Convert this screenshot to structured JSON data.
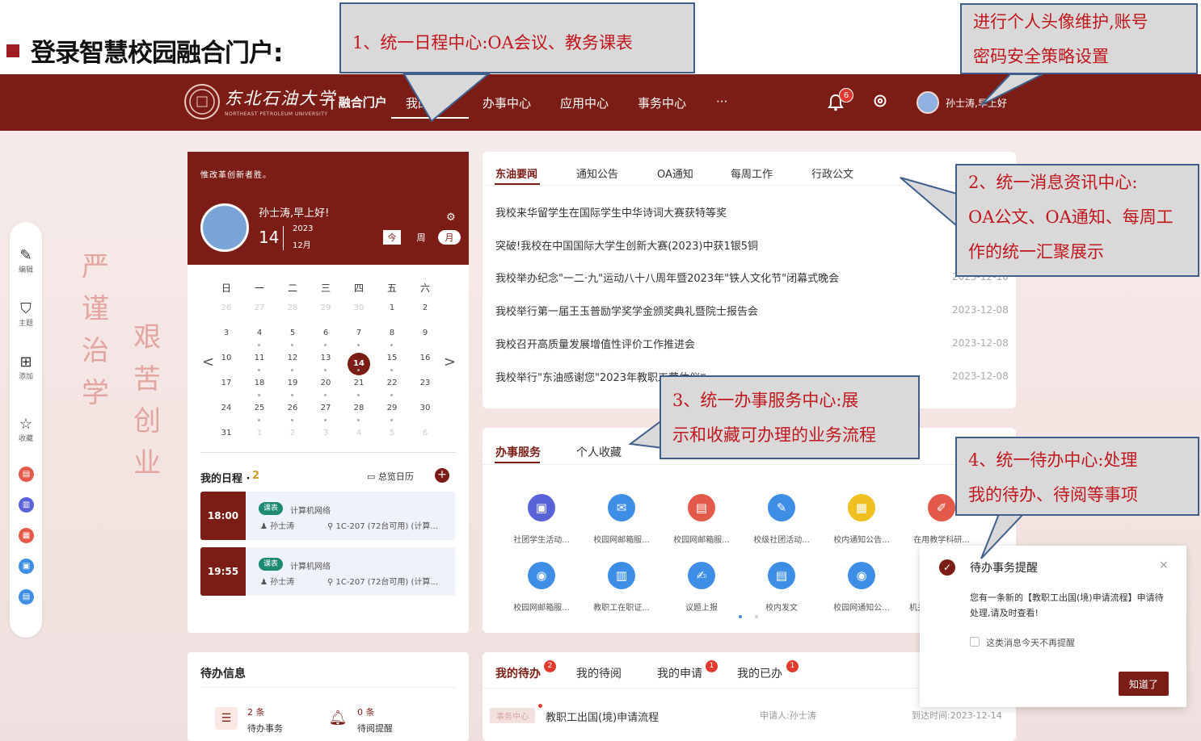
{
  "slide": {
    "title": "登录智慧校园融合门户:"
  },
  "callouts": {
    "c1": "1、统一日程中心:OA会议、教务课表",
    "c_top_right": [
      "进行个人头像维护,账号",
      "密码安全策略设置"
    ],
    "c2": [
      "2、统一消息资讯中心:",
      "OA公文、OA通知、每周工",
      "作的统一汇聚展示"
    ],
    "c3": [
      "3、统一办事服务中心:展",
      "示和收藏可办理的业务流程"
    ],
    "c4": [
      "4、统一待办中心:处理",
      "我的待办、待阅等事项"
    ]
  },
  "nav": {
    "university": "东北石油大学",
    "university_en": "NORTHEAST PETROLEUM UNIVERSITY",
    "portal": "| 融合门户",
    "items": [
      "我的门户",
      "办事中心",
      "应用中心",
      "事务中心",
      "···"
    ],
    "bell_badge": "6",
    "user": "孙士涛,早上好"
  },
  "deco": {
    "col1": [
      "严",
      "谨",
      "治",
      "学"
    ],
    "col2": [
      "艰",
      "苦",
      "创",
      "业"
    ]
  },
  "left_toolbar": [
    {
      "icon": "edit-icon",
      "label": "编辑"
    },
    {
      "icon": "theme-icon",
      "label": "主题"
    },
    {
      "icon": "add-icon",
      "label": "添加"
    },
    {
      "icon": "star-icon",
      "label": "收藏"
    }
  ],
  "calendar": {
    "motto": "惟改革创新者胜。",
    "greeting": "孙士涛,早上好!",
    "day": "14",
    "year": "2023",
    "month": "12月",
    "today_btn": "今",
    "week_btn": "周",
    "month_btn": "月",
    "weekdays": [
      "日",
      "一",
      "二",
      "三",
      "四",
      "五",
      "六"
    ],
    "prev": "<",
    "next": ">",
    "weeks": [
      [
        "26",
        "27",
        "28",
        "29",
        "30",
        "1",
        "2"
      ],
      [
        "3",
        "4",
        "5",
        "6",
        "7",
        "8",
        "9"
      ],
      [
        "10",
        "11",
        "12",
        "13",
        "14",
        "15",
        "16"
      ],
      [
        "17",
        "18",
        "19",
        "20",
        "21",
        "22",
        "23"
      ],
      [
        "24",
        "25",
        "26",
        "27",
        "28",
        "29",
        "30"
      ],
      [
        "31",
        "1",
        "2",
        "3",
        "4",
        "5",
        "6"
      ]
    ]
  },
  "schedule": {
    "title": "我的日程 ·",
    "count": "2",
    "all_label": "总览日历",
    "events": [
      {
        "time": "18:00",
        "tag": "课表",
        "name": "计算机网络",
        "person": "孙士涛",
        "place": "1C-207 (72台可用) (计算..."
      },
      {
        "time": "19:55",
        "tag": "课表",
        "name": "计算机网络",
        "person": "孙士涛",
        "place": "1C-207 (72台可用) (计算..."
      }
    ]
  },
  "news": {
    "tabs": [
      "东油要闻",
      "通知公告",
      "OA通知",
      "每周工作",
      "行政公文"
    ],
    "items": [
      {
        "title": "我校来华留学生在国际学生中华诗词大赛获特等奖",
        "date": ""
      },
      {
        "title": "突破!我校在中国国际大学生创新大赛(2023)中获1银5铜",
        "date": ""
      },
      {
        "title": "我校举办纪念\"一二·九\"运动八十八周年暨2023年\"铁人文化节\"闭幕式晚会",
        "date": "2023-12-10"
      },
      {
        "title": "我校举行第一届王玉普励学奖学金颁奖典礼暨院士报告会",
        "date": "2023-12-08"
      },
      {
        "title": "我校召开高质量发展增值性评价工作推进会",
        "date": "2023-12-08"
      },
      {
        "title": "我校举行\"东油感谢您\"2023年教职工荣休仪式",
        "date": "2023-12-08"
      }
    ]
  },
  "services": {
    "tabs": [
      "办事服务",
      "个人收藏"
    ],
    "items": [
      {
        "label": "社团学生活动...",
        "color": "#5a62d8",
        "icon": "basket-icon",
        "glyph": "▣"
      },
      {
        "label": "校园网邮箱服...",
        "color": "#3f8ee6",
        "icon": "mail-icon",
        "glyph": "✉"
      },
      {
        "label": "校园网邮箱服...",
        "color": "#e45a4a",
        "icon": "doc-lock-icon",
        "glyph": "▤"
      },
      {
        "label": "校级社团活动...",
        "color": "#3f8ee6",
        "icon": "form-icon",
        "glyph": "✎"
      },
      {
        "label": "校内通知公告...",
        "color": "#f0c020",
        "icon": "notice-icon",
        "glyph": "▦"
      },
      {
        "label": "在用教学科研...",
        "color": "#e45a4a",
        "icon": "tool-icon",
        "glyph": "✐"
      },
      {
        "label": "校园网邮箱服...",
        "color": "#3f8ee6",
        "icon": "user-icon",
        "glyph": "◉"
      },
      {
        "label": "教职工在职证...",
        "color": "#3f8ee6",
        "icon": "certificate-icon",
        "glyph": "▥"
      },
      {
        "label": "议题上报",
        "color": "#3f8ee6",
        "icon": "report-icon",
        "glyph": "✍"
      },
      {
        "label": "校内发文",
        "color": "#3f8ee6",
        "icon": "file-icon",
        "glyph": "▤"
      },
      {
        "label": "校园网通知公...",
        "color": "#3f8ee6",
        "icon": "user-icon",
        "glyph": "◉"
      },
      {
        "label": "机关",
        "color": "#3f8ee6",
        "icon": "building-icon",
        "glyph": "▦"
      }
    ]
  },
  "todo": {
    "title": "待办信息",
    "items": [
      {
        "count": "2 条",
        "label": "待办事务"
      },
      {
        "count": "0 条",
        "label": "待阅提醒"
      }
    ]
  },
  "mytodo": {
    "tabs": [
      {
        "label": "我的待办",
        "badge": "2"
      },
      {
        "label": "我的待阅",
        "badge": ""
      },
      {
        "label": "我的申请",
        "badge": "1"
      },
      {
        "label": "我的已办",
        "badge": "1"
      }
    ],
    "row": {
      "tag": "事务中心",
      "title": "教职工出国(境)申请流程",
      "applicant": "申请人:孙士涛",
      "arrive": "到达时间:2023-12-14"
    }
  },
  "popup": {
    "title": "待办事务提醒",
    "close": "×",
    "message": "您有一条新的【教职工出国(境)申请流程】申请待处理,请及时查看!",
    "option": "这类消息今天不再提醒",
    "button": "知道了"
  },
  "colors": {
    "brand": "#7b1d16",
    "callout_text": "#c0171e",
    "callout_border": "#3f5e8c",
    "badge": "#e03b2e"
  }
}
